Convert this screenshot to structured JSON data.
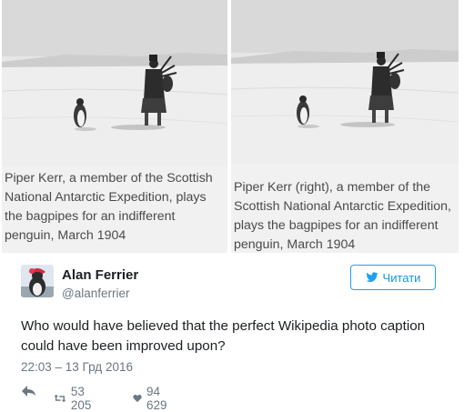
{
  "photos": [
    {
      "caption": "Piper Kerr, a member of the Scottish National Antarctic Expedition, plays the bagpipes for an indifferent penguin, March 1904"
    },
    {
      "caption": "Piper Kerr (right), a member of the Scottish National Antarctic Expedition, plays the bagpipes for an indifferent penguin, March 1904"
    }
  ],
  "tweet": {
    "author_name": "Alan Ferrier",
    "author_handle": "@alanferrier",
    "follow_label": "Читати",
    "text": "Who would have believed that the perfect Wikipedia photo caption could have been improved upon?",
    "timestamp": "22:03 – 13 Грд 2016",
    "retweets": "53 205",
    "likes": "94 629"
  },
  "colors": {
    "accent": "#1da1f2",
    "text": "#1c2022",
    "muted": "#697882",
    "caption_text": "#4a4a4a",
    "caption_bg": "#f1f1f1"
  },
  "icons": {
    "follow": "twitter-bird-icon",
    "reply": "reply-icon",
    "retweet": "retweet-icon",
    "like": "heart-icon"
  }
}
